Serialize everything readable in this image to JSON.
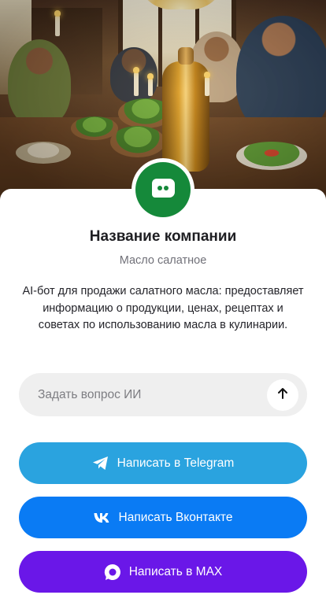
{
  "company": {
    "name": "Название компании",
    "subtitle": "Масло салатное",
    "description": "AI-бот для продажи салатного масла: предоставляет информацию о продукции, ценах, рецептах и советах по использованию масла в кулинарии.",
    "avatar_icon": "chat-bot-icon",
    "avatar_color": "#15893a"
  },
  "ask": {
    "placeholder": "Задать вопрос ИИ",
    "value": "",
    "send_icon": "arrow-up-icon"
  },
  "buttons": [
    {
      "label": "Написать в Telegram",
      "icon": "telegram-icon",
      "color": "#2aa3df"
    },
    {
      "label": "Написать Вконтакте",
      "icon": "vk-icon",
      "color": "#0a7bf4"
    },
    {
      "label": "Написать в MAX",
      "icon": "max-icon",
      "color": "#6a17e8"
    }
  ]
}
